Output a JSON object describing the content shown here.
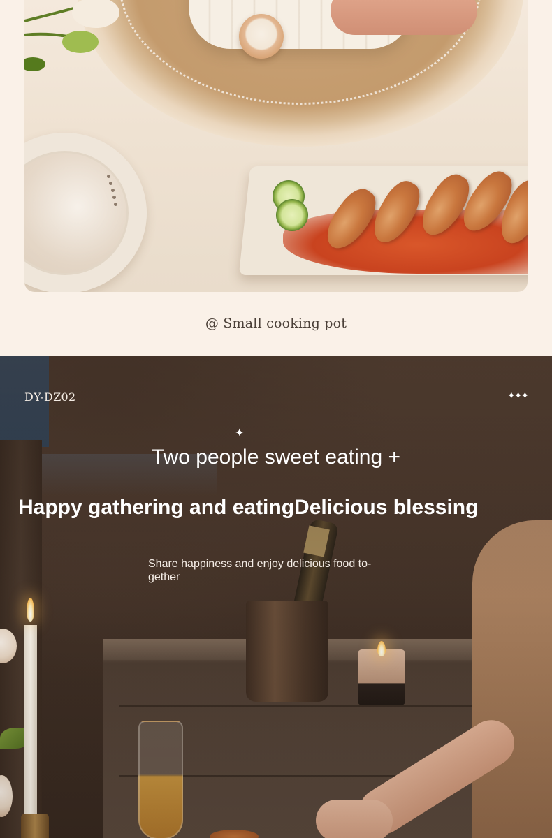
{
  "top_section": {
    "caption": "@ Small cooking pot"
  },
  "bottom_section": {
    "model_label": "DY-DZ02",
    "sparkle_decoration": "✦✦✦",
    "sparkle_small": "✦",
    "headline": "Two people sweet eating +",
    "subheadline": "Happy gathering and eatingDelicious blessing",
    "tagline": "Share happiness and enjoy delicious food to-gether"
  },
  "colors": {
    "page_background": "#faf1e8",
    "caption_text": "#4b4038",
    "bottom_text": "#ffffff",
    "bottom_background": "#4d3a2e"
  }
}
